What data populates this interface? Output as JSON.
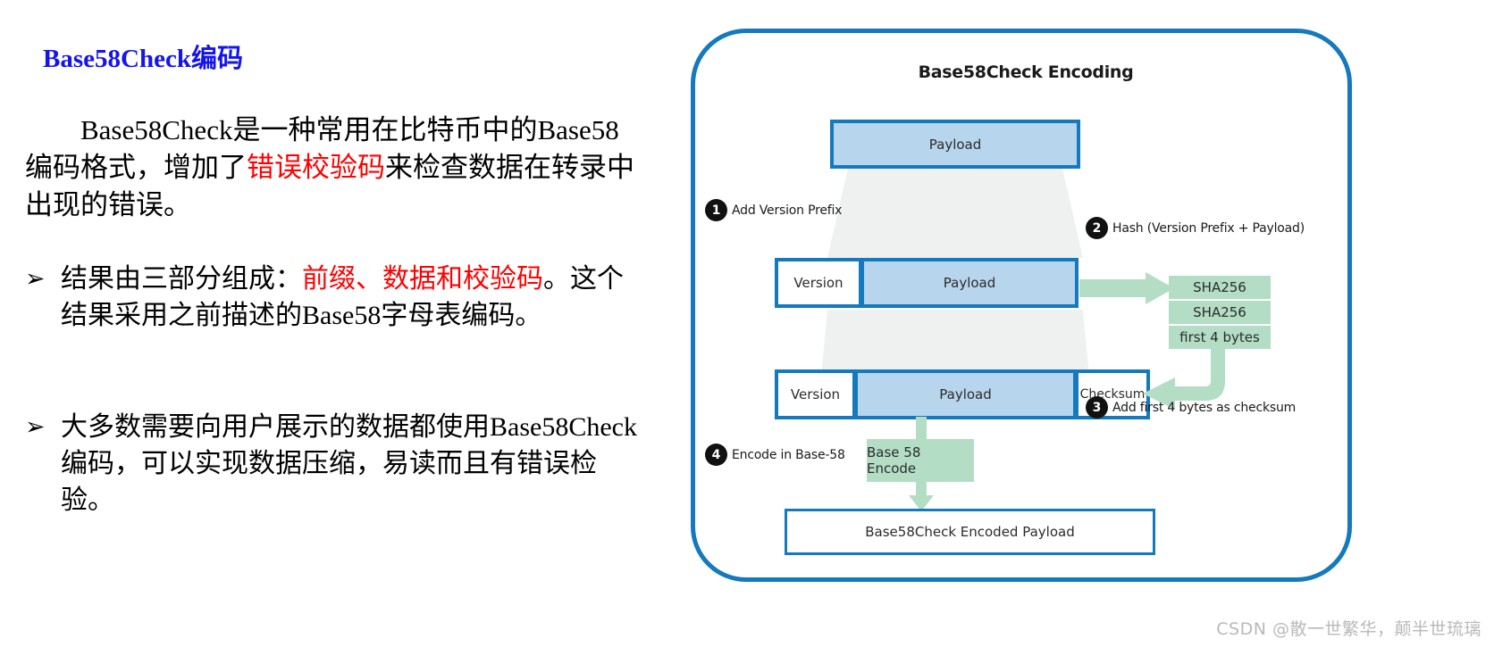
{
  "slide": {
    "title": "Base58Check编码",
    "intro": {
      "prefix": "Base58Check是一种常用在比特币中的Base58编码格式，增加了",
      "highlight": "错误校验码",
      "suffix": "来检查数据在转录中出现的错误。"
    },
    "bullets": [
      {
        "marker": "➢",
        "prefix": "结果由三部分组成：",
        "highlight": "前缀、数据和校验码",
        "suffix": "。这个结果采用之前描述的Base58字母表编码。"
      },
      {
        "marker": "➢",
        "prefix": "大多数需要向用户展示的数据都使用Base58Check编码，可以实现数据压缩，易读而且有错误检验。",
        "highlight": "",
        "suffix": ""
      }
    ]
  },
  "diagram": {
    "title": "Base58Check Encoding",
    "boxes": {
      "payload_1": "Payload",
      "row2_version": "Version",
      "row2_payload": "Payload",
      "row3_version": "Version",
      "row3_payload": "Payload",
      "row3_checksum": "Checksum",
      "final": "Base58Check Encoded Payload",
      "encode": "Base 58 Encode"
    },
    "hashes": [
      "SHA256",
      "SHA256",
      "first 4 bytes"
    ],
    "steps": [
      {
        "num": "1",
        "label": "Add Version Prefix"
      },
      {
        "num": "2",
        "label": "Hash (Version Prefix + Payload)"
      },
      {
        "num": "3",
        "label": "Add first 4 bytes as checksum"
      },
      {
        "num": "4",
        "label": "Encode in Base-58"
      }
    ],
    "colors": {
      "border_blue": "#1479bd",
      "fill_blue": "#b7d5ec",
      "fill_green": "#b3ddc5",
      "funnel_grey": "#eff0f0",
      "badge_black": "#111111"
    }
  },
  "watermark": "CSDN @散一世繁华，颠半世琉璃"
}
